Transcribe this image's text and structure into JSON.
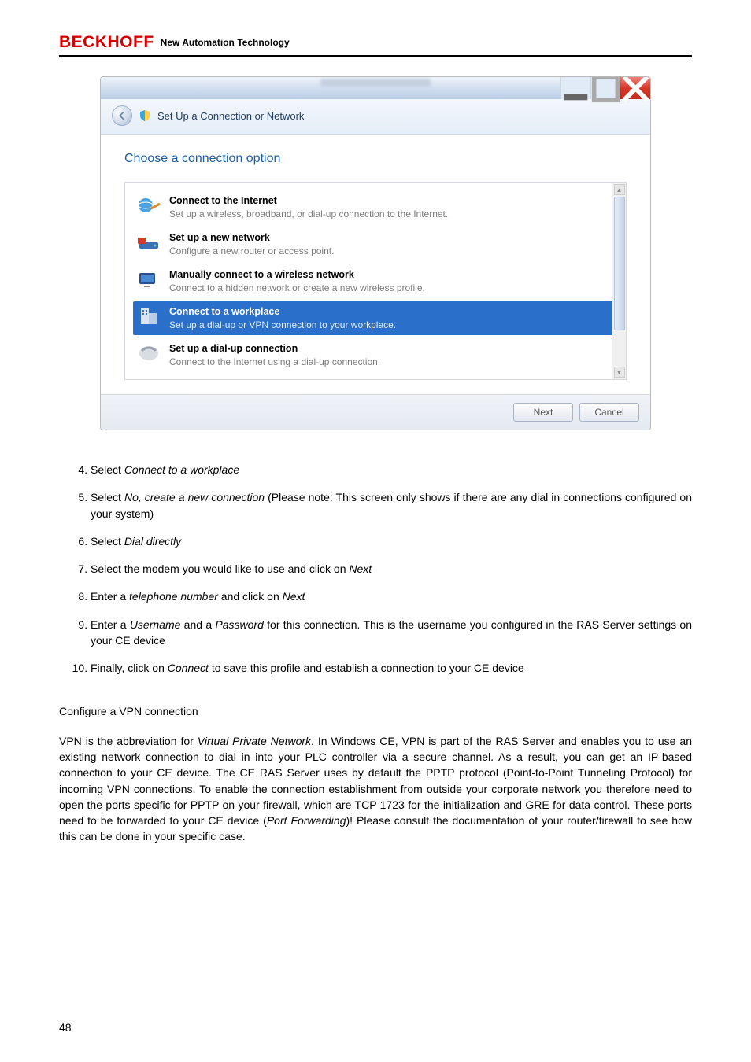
{
  "brand": "BECKHOFF",
  "tagline": "New Automation Technology",
  "dialog": {
    "nav_title": "Set Up a Connection or Network",
    "heading": "Choose a connection option",
    "options": [
      {
        "title": "Connect to the Internet",
        "desc": "Set up a wireless, broadband, or dial-up connection to the Internet."
      },
      {
        "title": "Set up a new network",
        "desc": "Configure a new router or access point."
      },
      {
        "title": "Manually connect to a wireless network",
        "desc": "Connect to a hidden network or create a new wireless profile."
      },
      {
        "title": "Connect to a workplace",
        "desc": "Set up a dial-up or VPN connection to your workplace."
      },
      {
        "title": "Set up a dial-up connection",
        "desc": "Connect to the Internet using a dial-up connection."
      }
    ],
    "next_label": "Next",
    "cancel_label": "Cancel"
  },
  "steps": {
    "s4_a": "Select ",
    "s4_i": "Connect to a workplace",
    "s5_a": "Select ",
    "s5_i": "No, create a new connection",
    "s5_b": " (Please note: This screen only shows if there are any dial in connections configured on your system)",
    "s6_a": "Select ",
    "s6_i": "Dial directly",
    "s7_a": "Select the modem you would like to use and click on ",
    "s7_i": "Next",
    "s8_a": "Enter a ",
    "s8_i": "telephone number",
    "s8_b": " and click on ",
    "s8_j": "Next",
    "s9_a": "Enter a ",
    "s9_i": "Username",
    "s9_b": " and a ",
    "s9_j": "Password",
    "s9_c": " for this connection. This is the username you configured in the RAS Server settings on your CE device",
    "s10_a": "Finally, click on ",
    "s10_i": "Connect",
    "s10_b": " to save this profile and establish a connection to your CE device"
  },
  "section_title": "Configure a VPN connection",
  "para_a": "VPN is the abbreviation for ",
  "para_i": "Virtual Private Network",
  "para_b": ". In Windows CE, VPN is part of the RAS Server and enables you to use an existing network connection to dial in into your PLC controller via a secure channel. As a result, you can get an IP-based connection to your CE device. The CE RAS Server uses by default the PPTP protocol (Point-to-Point Tunneling Protocol) for incoming VPN connections. To enable the connection establishment from outside your corporate network you therefore need to open the ports specific for PPTP on your firewall, which are TCP 1723 for the initialization and GRE for data control. These ports need to be forwarded to your CE device (",
  "para_j": "Port Forwarding",
  "para_c": ")! Please consult the documentation of your router/firewall to see how this can be done in your specific case.",
  "pagenum": "48"
}
